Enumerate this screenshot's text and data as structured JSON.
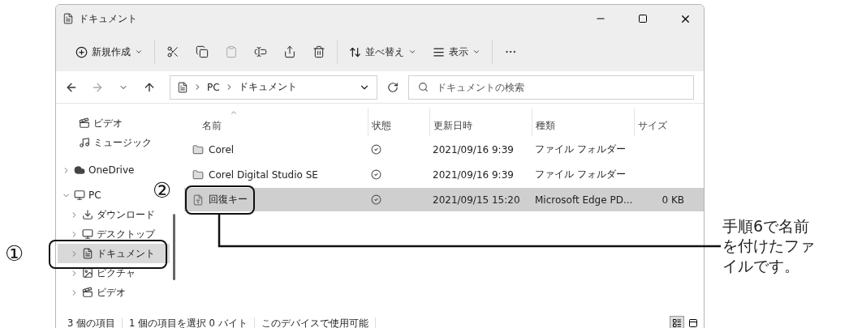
{
  "window": {
    "title": "ドキュメント"
  },
  "toolbar": {
    "groups": [
      [
        {
          "kind": "menu",
          "label": "新規作成"
        }
      ],
      [
        {
          "kind": "cut",
          "disabled": false
        },
        {
          "kind": "copy",
          "disabled": false
        },
        {
          "kind": "paste",
          "disabled": true
        },
        {
          "kind": "rename",
          "disabled": false
        },
        {
          "kind": "share",
          "disabled": false
        },
        {
          "kind": "delete",
          "disabled": false
        }
      ],
      [
        {
          "kind": "menu",
          "label": "並べ替え"
        },
        {
          "kind": "menu",
          "label": "表示"
        }
      ],
      [
        {
          "kind": "more",
          "disabled": false
        }
      ]
    ]
  },
  "nav": [
    {
      "kind": "back",
      "disabled": false
    },
    {
      "kind": "forward",
      "disabled": true
    },
    {
      "kind": "recent",
      "disabled": false
    },
    {
      "kind": "up",
      "disabled": false
    }
  ],
  "address": {
    "path": [
      "PC",
      "ドキュメント"
    ]
  },
  "search": {
    "placeholder": "ドキュメントの検索"
  },
  "sidebar": {
    "items": [
      {
        "label": "ビデオ",
        "kind": "video",
        "selected": false
      },
      {
        "label": "ミュージック",
        "kind": "music",
        "selected": false
      },
      {
        "label": "OneDrive",
        "kind": "cloud",
        "selected": false,
        "expanded": false
      },
      {
        "label": "PC",
        "kind": "pc",
        "selected": false,
        "expanded": true,
        "children": [
          {
            "label": "ダウンロード",
            "kind": "download",
            "selected": false,
            "expanded": false
          },
          {
            "label": "デスクトップ",
            "kind": "desktop",
            "selected": false,
            "expanded": false
          },
          {
            "label": "ドキュメント",
            "kind": "document",
            "selected": true,
            "expanded": false
          },
          {
            "label": "ピクチャ",
            "kind": "picture",
            "selected": false,
            "expanded": false
          },
          {
            "label": "ビデオ",
            "kind": "video",
            "selected": false,
            "expanded": false
          }
        ]
      }
    ]
  },
  "columns": [
    {
      "label": "名前",
      "sorted": true
    },
    {
      "label": "状態",
      "sorted": false
    },
    {
      "label": "更新日時",
      "sorted": false
    },
    {
      "label": "種類",
      "sorted": false
    },
    {
      "label": "サイズ",
      "sorted": false
    }
  ],
  "rows": [
    {
      "kind": "folder",
      "name": "Corel",
      "date": "2021/09/16 9:39",
      "type": "ファイル フォルダー",
      "selected": false
    },
    {
      "kind": "folder",
      "name": "Corel Digital Studio SE",
      "date": "2021/09/16 9:39",
      "type": "ファイル フォルダー",
      "selected": false
    },
    {
      "kind": "pdf",
      "name": "回復キー",
      "date": "2021/09/15 15:20",
      "type": "Microsoft Edge PD...",
      "size": "0 KB",
      "selected": true
    }
  ],
  "status_bar": {
    "items": [
      "3 個の項目",
      "1 個の項目を選択 0 バイト",
      "このデバイスで使用可能"
    ],
    "views": [
      {
        "kind": "details",
        "selected": true
      },
      {
        "kind": "tiles",
        "selected": false
      }
    ]
  },
  "annotations": {
    "markers": [
      "①",
      "②"
    ],
    "note": "手順6で名前を付けたファイルです。"
  }
}
